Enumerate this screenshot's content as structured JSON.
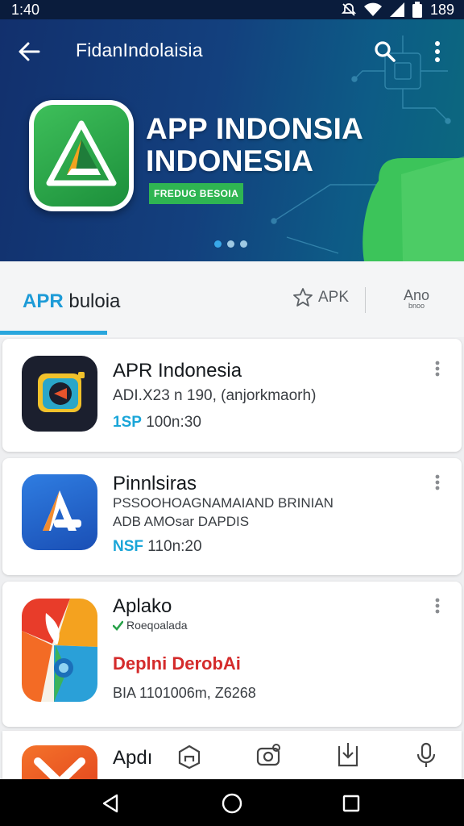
{
  "status_bar": {
    "time": "1:40",
    "battery": "189"
  },
  "toolbar": {
    "title": "FidanIndolaisia"
  },
  "hero": {
    "title_line1": "APP INDONSIA",
    "title_line2": "INDONESIA",
    "badge": "FREDUG BESOIA",
    "dots_count": 3,
    "active_dot": 0
  },
  "tabs": {
    "active_accent": "APR",
    "active_rest": "buloia",
    "apk_label": "APK",
    "ano_label": "Ano",
    "ano_sublabel": "bnoo"
  },
  "apps": [
    {
      "name": "APR Indonesia",
      "line1": "ADI.X23 n 190, (anjorkmaorh)",
      "meta_key": "1SP",
      "meta_value": "100n:30"
    },
    {
      "name": "Pinnlsiras",
      "line1": "PSSOOHOAGNAMAIAND BRINIAN",
      "line2": "ADB AMOsar DAPDIS",
      "meta_key": "NSF",
      "meta_value": "110n:20"
    },
    {
      "name": "Aplako",
      "verified_text": "Roeqoalada",
      "promo": "Deplni DerobAi",
      "meta_value": "BIA 1101006m, Z6268"
    },
    {
      "name": "Apdı"
    }
  ],
  "colors": {
    "accent": "#1d9bd7",
    "promo": "#d42b2b",
    "hero_green": "#2fb552"
  }
}
